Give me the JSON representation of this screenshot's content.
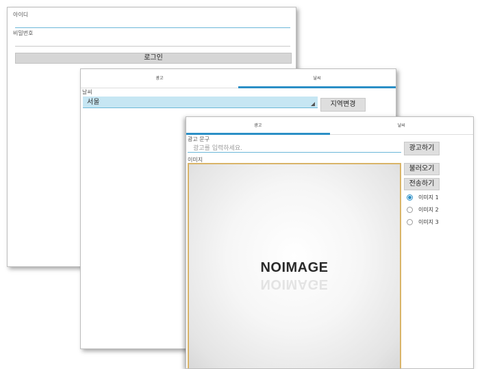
{
  "login": {
    "id_label": "아이디",
    "pw_label": "비밀번호",
    "login_button": "로그인"
  },
  "weather": {
    "tabs": [
      "광고",
      "날씨"
    ],
    "selected_tab": "날씨",
    "section_label": "날씨",
    "city_value": "서울",
    "change_region_button": "지역변경"
  },
  "ad": {
    "tabs": [
      "광고",
      "날씨"
    ],
    "selected_tab": "광고",
    "text_label": "광고 문구",
    "text_placeholder": "광고를 입력하세요.",
    "advertise_button": "광고하기",
    "image_label": "이미지",
    "image_placeholder_text": "NOIMAGE",
    "load_button": "불러오기",
    "send_button": "전송하기",
    "image_options": [
      {
        "label": "이미지 1",
        "selected": true
      },
      {
        "label": "이미지 2",
        "selected": false
      },
      {
        "label": "이미지 3",
        "selected": false
      }
    ]
  },
  "colors": {
    "accent": "#2b8fc6",
    "select_bg": "#c6e6f3",
    "image_border": "#d9b468"
  }
}
